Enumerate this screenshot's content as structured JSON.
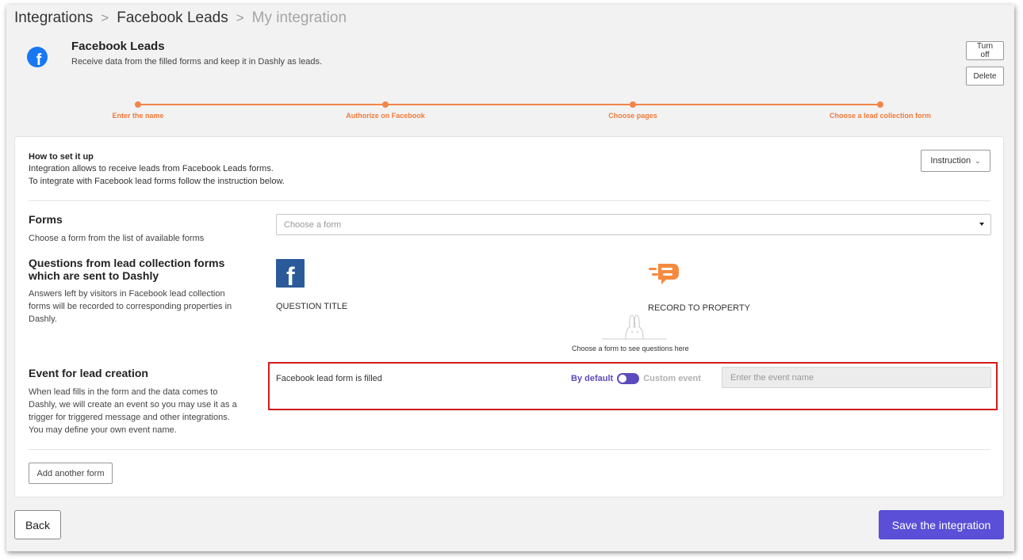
{
  "breadcrumb": {
    "items": [
      "Integrations",
      "Facebook Leads"
    ],
    "current": "My integration",
    "separator": ">"
  },
  "integration": {
    "title": "Facebook Leads",
    "description": "Receive data from the filled forms and keep it in Dashly as leads.",
    "logo_icon": "facebook-round-icon",
    "logo_letter": "f"
  },
  "header_actions": {
    "turn_off_label": "Turn off",
    "delete_label": "Delete"
  },
  "stepper": {
    "color": "#f2854a",
    "steps": [
      {
        "label": "Enter the name"
      },
      {
        "label": "Authorize on Facebook"
      },
      {
        "label": "Choose pages"
      },
      {
        "label": "Choose a lead collection form"
      }
    ]
  },
  "howto": {
    "title": "How to set it up",
    "line1": "Integration allows to receive leads from Facebook Leads forms.",
    "line2": "To integrate with Facebook lead forms follow the instruction below.",
    "instruction_label": "Instruction",
    "instruction_icon": "chevron-down-icon"
  },
  "forms": {
    "title": "Forms",
    "description": "Choose a form from the list of available forms",
    "select_placeholder": "Choose a form"
  },
  "questions": {
    "title_line1": "Questions from lead collection forms",
    "title_line2": "which are sent to Dashly",
    "desc_line1": "Answers left by visitors in Facebook lead collection",
    "desc_line2": "forms will be recorded to corresponding properties in",
    "desc_line3": "Dashly.",
    "question_col_label": "QUESTION TITLE",
    "question_col_letter": "f",
    "property_col_label": "RECORD TO PROPERTY",
    "empty_hint": "Choose a form to see questions here"
  },
  "event": {
    "title": "Event for lead creation",
    "desc_line1": "When lead fills in the form and the data comes to",
    "desc_line2": "Dashly, we will create an event so you may use it as a",
    "desc_line3": "trigger for triggered message and other integrations.",
    "desc_line4": "You may define your own event name.",
    "row_label": "Facebook lead form is filled",
    "option_default": "By default",
    "option_custom": "Custom event",
    "toggle_state": "By default",
    "input_placeholder": "Enter the event name",
    "highlight_color": "#d21b1b"
  },
  "add_form_label": "Add another form",
  "footer": {
    "back_label": "Back",
    "save_label": "Save the integration",
    "accent_color": "#5a4fd6"
  }
}
